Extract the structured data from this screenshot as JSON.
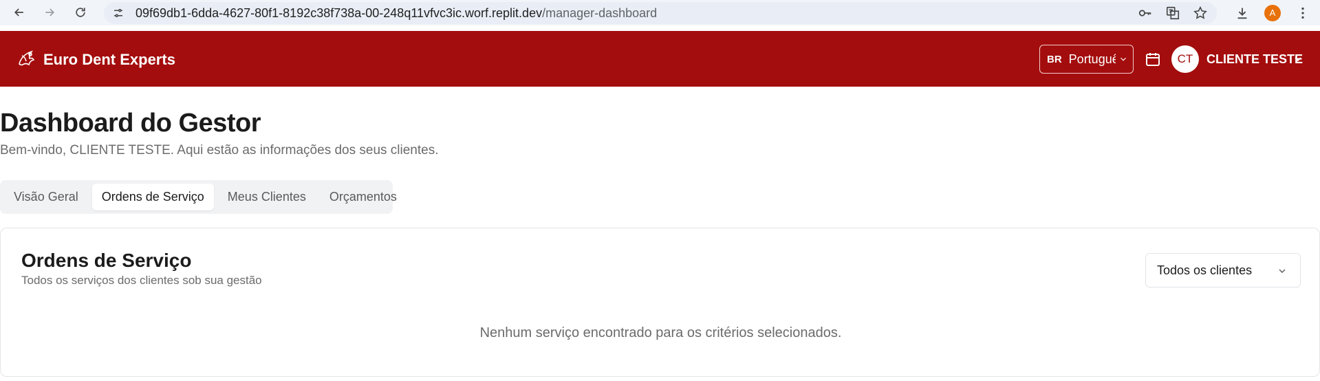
{
  "browser": {
    "url_host": "09f69db1-6dda-4627-80f1-8192c38f738a-00-248q11vfvc3ic.worf.replit.dev",
    "url_path": "/manager-dashboard",
    "profile_initial": "A",
    "icons": [
      "back-arrow-icon",
      "forward-arrow-icon",
      "reload-icon",
      "site-info-icon",
      "key-icon",
      "translate-icon",
      "star-icon",
      "download-icon",
      "kebab-menu-icon"
    ]
  },
  "header": {
    "brand": "Euro Dent Experts",
    "language": {
      "code": "BR",
      "label": "Português"
    },
    "user_initials": "CT",
    "user_name": "CLIENTE TESTE",
    "colors": {
      "primary": "#a40d0d"
    }
  },
  "page": {
    "title": "Dashboard do Gestor",
    "subtitle": "Bem-vindo, CLIENTE TESTE. Aqui estão as informações dos seus clientes."
  },
  "tabs": [
    {
      "label": "Visão Geral",
      "active": false
    },
    {
      "label": "Ordens de Serviço",
      "active": true
    },
    {
      "label": "Meus Clientes",
      "active": false
    },
    {
      "label": "Orçamentos",
      "active": false
    }
  ],
  "card": {
    "title": "Ordens de Serviço",
    "subtitle": "Todos os serviços dos clientes sob sua gestão",
    "filter_value": "Todos os clientes",
    "empty_message": "Nenhum serviço encontrado para os critérios selecionados."
  }
}
